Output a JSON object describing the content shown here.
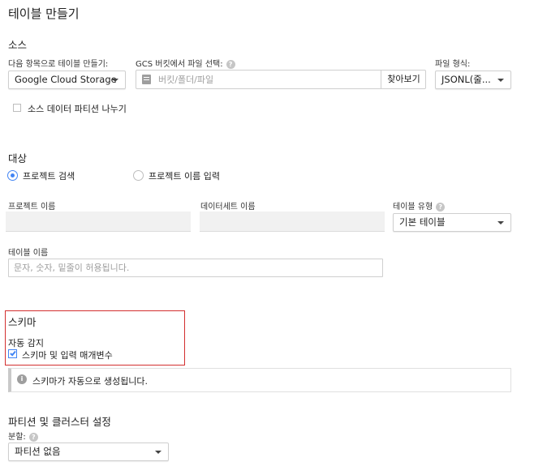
{
  "page_title": "테이블 만들기",
  "source": {
    "heading": "소스",
    "create_from_label": "다음 항목으로 테이블 만들기:",
    "create_from_value": "Google Cloud Storage",
    "gcs_label": "GCS 버킷에서 파일 선택:",
    "gcs_placeholder": "버킷/폴더/파일",
    "browse_button": "찾아보기",
    "file_format_label": "파일 형식:",
    "file_format_value": "JSONL(줄...",
    "partition_source_checkbox": "소스 데이터 파티션 나누기"
  },
  "destination": {
    "heading": "대상",
    "radio_search": "프로젝트 검색",
    "radio_enter": "프로젝트 이름 입력",
    "project_label": "프로젝트 이름",
    "dataset_label": "데이터세트 이름",
    "table_type_label": "테이블 유형",
    "table_type_value": "기본 테이블",
    "table_name_label": "테이블 이름",
    "table_name_placeholder": "문자, 숫자, 밑줄이 허용됩니다."
  },
  "schema": {
    "heading": "스키마",
    "auto_detect_label": "자동 감지",
    "checkbox_label": "스키마 및 입력 매개변수",
    "info_message": "스키마가 자동으로 생성됩니다."
  },
  "partition": {
    "heading": "파티션 및 클러스터 설정",
    "split_label": "분할:",
    "split_value": "파티션 없음"
  },
  "colors": {
    "accent": "#4285f4",
    "highlight_border": "#d32f2f"
  },
  "icons": [
    "help-icon",
    "file-icon",
    "dropdown-caret-icon",
    "info-icon",
    "checkbox-checked-icon"
  ]
}
